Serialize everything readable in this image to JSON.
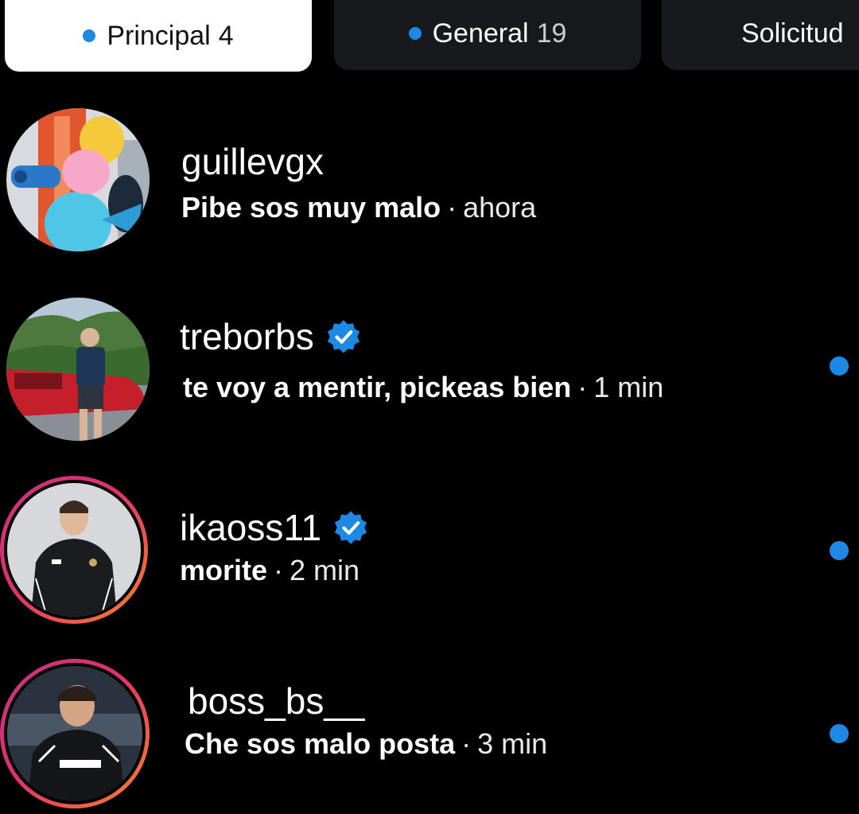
{
  "tabs": [
    {
      "label": "Principal",
      "count": "4",
      "active": true
    },
    {
      "label": "General",
      "count": "19",
      "active": false
    },
    {
      "label": "Solicitud",
      "count": "",
      "active": false
    }
  ],
  "threads": [
    {
      "username": "guillevgx",
      "verified": false,
      "message": "Pibe sos muy malo",
      "time": "ahora",
      "unread": false
    },
    {
      "username": "treborbs",
      "verified": true,
      "message": "te voy a mentir,  pickeas bien",
      "time": "1 min",
      "unread": true
    },
    {
      "username": "ikaoss11",
      "verified": true,
      "message": "morite",
      "time": "2 min",
      "unread": true
    },
    {
      "username": "boss_bs__",
      "verified": false,
      "message": "Che sos malo posta",
      "time": "3 min",
      "unread": true
    }
  ],
  "separator": "·",
  "colors": {
    "background": "#000000",
    "accent_blue": "#1e88e5",
    "story_ring_start": "#f58529",
    "story_ring_end": "#c13584"
  },
  "icons": {
    "verified": "verified-badge-icon",
    "unread": "unread-dot-icon"
  }
}
